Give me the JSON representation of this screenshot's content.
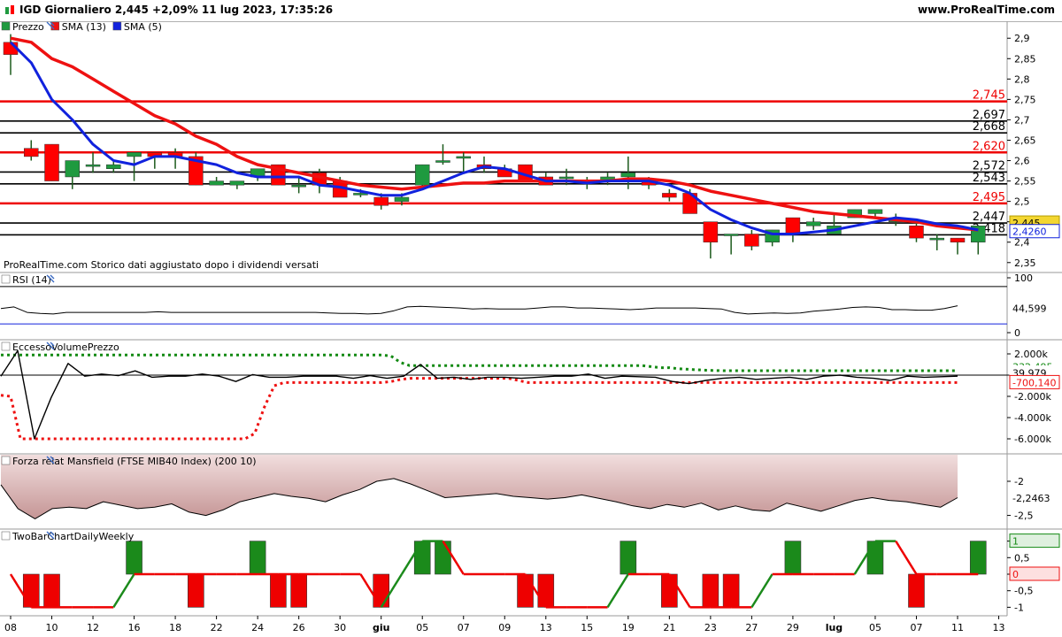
{
  "header": {
    "title": "IGD Giornaliero 2,445 +2,09% 11 lug 2023, 17:35:26",
    "brand": "www.ProRealTime.com",
    "close_label": "✕"
  },
  "colors": {
    "up": "#1f9a3f",
    "down": "#ff0000",
    "sma13": "#ee1111",
    "sma5": "#1122dd",
    "line_red": "#ee0000",
    "line_black": "#000000",
    "rsi_line": "#000000",
    "rsi_level": "#1122dd",
    "evp_green": "#148a14",
    "evp_red": "#ee1111",
    "mansfield_fill": "#d2a4a4",
    "tb_up": "#1b8a1b",
    "tb_down": "#ee0000"
  },
  "x_axis": {
    "labels": [
      "08",
      "10",
      "12",
      "16",
      "18",
      "22",
      "24",
      "26",
      "30",
      "giu",
      "05",
      "07",
      "09",
      "13",
      "15",
      "19",
      "21",
      "23",
      "27",
      "29",
      "lug",
      "05",
      "07",
      "11",
      "13"
    ],
    "label_index": [
      0,
      2,
      4,
      6,
      8,
      10,
      12,
      14,
      16,
      18,
      20,
      22,
      24,
      26,
      28,
      30,
      32,
      34,
      36,
      38,
      40,
      42,
      44,
      46,
      48
    ]
  },
  "price_panel": {
    "legend": [
      {
        "text": "Prezzo",
        "color": "#1f9a3f"
      },
      {
        "text": "SMA (13)",
        "color": "#ee1111"
      },
      {
        "text": "SMA (5)",
        "color": "#1122dd"
      }
    ],
    "note": "ProRealTime.com  Storico dati aggiustato dopo i dividendi versati",
    "y_ticks": [
      "2,9",
      "2,85",
      "2,8",
      "2,75",
      "2,7",
      "2,65",
      "2,6",
      "2,55",
      "2,5",
      "2,45",
      "2,4",
      "2,35"
    ],
    "y_tick_values": [
      2.9,
      2.85,
      2.8,
      2.75,
      2.7,
      2.65,
      2.6,
      2.55,
      2.5,
      2.45,
      2.4,
      2.35
    ],
    "current_price": "2,445",
    "current_sma": "2,4260"
  },
  "chart_data": [
    {
      "type": "candlestick",
      "title": "Prezzo",
      "ylim": [
        2.33,
        2.92
      ],
      "candles": [
        [
          2.89,
          2.91,
          2.81,
          2.86
        ],
        [
          2.63,
          2.65,
          2.6,
          2.61
        ],
        [
          2.64,
          2.64,
          2.55,
          2.55
        ],
        [
          2.56,
          2.59,
          2.53,
          2.6
        ],
        [
          2.59,
          2.62,
          2.57,
          2.59
        ],
        [
          2.58,
          2.6,
          2.57,
          2.59
        ],
        [
          2.61,
          2.62,
          2.55,
          2.62
        ],
        [
          2.62,
          2.62,
          2.58,
          2.61
        ],
        [
          2.62,
          2.63,
          2.58,
          2.61
        ],
        [
          2.61,
          2.62,
          2.54,
          2.54
        ],
        [
          2.54,
          2.56,
          2.54,
          2.55
        ],
        [
          2.54,
          2.55,
          2.53,
          2.55
        ],
        [
          2.56,
          2.58,
          2.55,
          2.58
        ],
        [
          2.59,
          2.59,
          2.54,
          2.54
        ],
        [
          2.54,
          2.56,
          2.52,
          2.54
        ],
        [
          2.57,
          2.58,
          2.52,
          2.54
        ],
        [
          2.55,
          2.56,
          2.51,
          2.51
        ],
        [
          2.52,
          2.53,
          2.51,
          2.52
        ],
        [
          2.51,
          2.52,
          2.48,
          2.49
        ],
        [
          2.5,
          2.52,
          2.49,
          2.51
        ],
        [
          2.54,
          2.59,
          2.53,
          2.59
        ],
        [
          2.6,
          2.64,
          2.59,
          2.6
        ],
        [
          2.61,
          2.62,
          2.57,
          2.61
        ],
        [
          2.59,
          2.61,
          2.57,
          2.58
        ],
        [
          2.58,
          2.59,
          2.57,
          2.56
        ],
        [
          2.59,
          2.59,
          2.55,
          2.55
        ],
        [
          2.56,
          2.57,
          2.54,
          2.54
        ],
        [
          2.56,
          2.58,
          2.54,
          2.56
        ],
        [
          2.55,
          2.56,
          2.53,
          2.55
        ],
        [
          2.55,
          2.57,
          2.54,
          2.56
        ],
        [
          2.56,
          2.61,
          2.53,
          2.57
        ],
        [
          2.55,
          2.56,
          2.53,
          2.54
        ],
        [
          2.52,
          2.53,
          2.5,
          2.51
        ],
        [
          2.52,
          2.53,
          2.47,
          2.47
        ],
        [
          2.45,
          2.45,
          2.36,
          2.4
        ],
        [
          2.42,
          2.42,
          2.37,
          2.42
        ],
        [
          2.42,
          2.43,
          2.38,
          2.39
        ],
        [
          2.4,
          2.43,
          2.39,
          2.43
        ],
        [
          2.46,
          2.46,
          2.4,
          2.42
        ],
        [
          2.44,
          2.46,
          2.43,
          2.45
        ],
        [
          2.42,
          2.47,
          2.42,
          2.44
        ],
        [
          2.46,
          2.48,
          2.46,
          2.48
        ],
        [
          2.47,
          2.48,
          2.46,
          2.48
        ],
        [
          2.45,
          2.47,
          2.44,
          2.46
        ],
        [
          2.44,
          2.45,
          2.4,
          2.41
        ],
        [
          2.41,
          2.42,
          2.38,
          2.41
        ],
        [
          2.41,
          2.41,
          2.37,
          2.4
        ],
        [
          2.4,
          2.44,
          2.37,
          2.44
        ]
      ],
      "sma13": [
        2.9,
        2.89,
        2.85,
        2.83,
        2.8,
        2.77,
        2.74,
        2.71,
        2.69,
        2.66,
        2.64,
        2.61,
        2.59,
        2.58,
        2.57,
        2.56,
        2.55,
        2.54,
        2.535,
        2.53,
        2.535,
        2.54,
        2.545,
        2.545,
        2.55,
        2.55,
        2.55,
        2.55,
        2.55,
        2.55,
        2.555,
        2.555,
        2.55,
        2.54,
        2.525,
        2.515,
        2.505,
        2.495,
        2.485,
        2.475,
        2.47,
        2.465,
        2.46,
        2.455,
        2.45,
        2.44,
        2.435,
        2.43
      ],
      "sma5": [
        2.89,
        2.84,
        2.75,
        2.7,
        2.64,
        2.6,
        2.59,
        2.61,
        2.61,
        2.6,
        2.59,
        2.57,
        2.56,
        2.56,
        2.56,
        2.54,
        2.535,
        2.525,
        2.515,
        2.515,
        2.53,
        2.55,
        2.57,
        2.585,
        2.58,
        2.565,
        2.55,
        2.55,
        2.545,
        2.55,
        2.55,
        2.55,
        2.54,
        2.52,
        2.48,
        2.455,
        2.435,
        2.42,
        2.42,
        2.425,
        2.43,
        2.44,
        2.45,
        2.46,
        2.455,
        2.445,
        2.44,
        2.43
      ],
      "levels": [
        {
          "value": 2.745,
          "label": "2,745",
          "color": "#ee0000"
        },
        {
          "value": 2.697,
          "label": "2,697",
          "color": "#000000"
        },
        {
          "value": 2.668,
          "label": "2,668",
          "color": "#000000"
        },
        {
          "value": 2.62,
          "label": "2,620",
          "color": "#ee0000"
        },
        {
          "value": 2.572,
          "label": "2,572",
          "color": "#000000"
        },
        {
          "value": 2.543,
          "label": "2,543",
          "color": "#000000"
        },
        {
          "value": 2.495,
          "label": "2,495",
          "color": "#ee0000"
        },
        {
          "value": 2.447,
          "label": "2,447",
          "color": "#000000"
        },
        {
          "value": 2.418,
          "label": "2,418",
          "color": "#000000"
        }
      ]
    },
    {
      "type": "line",
      "title": "RSI (14)",
      "ylim": [
        0,
        100
      ],
      "ticks": [
        "100",
        "0"
      ],
      "tick_values": [
        100,
        0
      ],
      "level_top": 84,
      "level_bottom": 16,
      "current": "44,599",
      "values": [
        44,
        47,
        37,
        35,
        34,
        37,
        37,
        37,
        37,
        37,
        37,
        37,
        38,
        37,
        37,
        37,
        37,
        37,
        37,
        37,
        37,
        37,
        37,
        37,
        37,
        36,
        35,
        35,
        34,
        35,
        40,
        47,
        48,
        47,
        46,
        45,
        43,
        44,
        43,
        43,
        43,
        45,
        47,
        47,
        45,
        45,
        44,
        43,
        42,
        43,
        45,
        45,
        45,
        45,
        44,
        43,
        37,
        34,
        35,
        36,
        35,
        36,
        39,
        41,
        43,
        46,
        47,
        46,
        42,
        42,
        41,
        41,
        44,
        49
      ]
    },
    {
      "type": "line",
      "title": "EccessoVolumePrezzo",
      "ylim": [
        -7000,
        2500
      ],
      "ticks": [
        "2.000k",
        "0",
        "-2.000k",
        "-4.000k",
        "-6.000k"
      ],
      "tick_values": [
        2000,
        0,
        -2000,
        -4000,
        -6000
      ],
      "current_green": "332,495",
      "current_black": "39,979",
      "current_red": "-700,140",
      "series": [
        {
          "name": "green",
          "values": [
            1900,
            1900,
            1900,
            1900,
            1900,
            1900,
            1900,
            1900,
            1900,
            1900,
            1900,
            1900,
            1900,
            1900,
            1900,
            1900,
            1900,
            1900,
            1900,
            1900,
            1900,
            1900,
            1900,
            1900,
            1900,
            1900,
            1900,
            1900,
            1900,
            1900,
            1900,
            1900,
            1900,
            1900,
            1900,
            1900,
            1900,
            1900,
            1900,
            1900,
            1900,
            1900,
            1800,
            1200,
            900,
            900,
            900,
            900,
            900,
            900,
            900,
            900,
            900,
            900,
            900,
            900,
            900,
            900,
            900,
            900,
            900,
            900,
            900,
            900,
            900,
            900,
            900,
            900,
            900,
            900,
            800,
            700,
            700,
            600,
            550,
            500,
            460,
            430,
            420,
            420,
            420,
            420,
            420,
            420,
            420,
            420,
            420,
            420,
            420,
            420,
            420,
            420,
            420,
            420,
            420,
            420,
            420,
            420,
            420,
            420,
            420,
            420,
            420,
            420
          ]
        },
        {
          "name": "black",
          "values": [
            -100,
            2300,
            -6000,
            -2100,
            1100,
            -100,
            100,
            -50,
            400,
            -200,
            -100,
            -100,
            100,
            -100,
            -600,
            50,
            -200,
            -200,
            -100,
            -100,
            -100,
            -300,
            -50,
            -300,
            -100,
            1000,
            -300,
            -200,
            -400,
            -200,
            -200,
            -300,
            -200,
            -100,
            -100,
            100,
            -300,
            -100,
            -150,
            -200,
            -600,
            -800,
            -500,
            -300,
            -200,
            -400,
            -300,
            -200,
            -400,
            -100,
            0,
            -200,
            -300,
            -500,
            -100,
            -200,
            -150,
            -100
          ]
        },
        {
          "name": "red",
          "values": [
            -1900,
            -2000,
            -6000,
            -6000,
            -6000,
            -6000,
            -6000,
            -6000,
            -6000,
            -6000,
            -6000,
            -6000,
            -6000,
            -6000,
            -6000,
            -6000,
            -6000,
            -6000,
            -6000,
            -6000,
            -6000,
            -6000,
            -6000,
            -6000,
            -6000,
            -6000,
            -5500,
            -3000,
            -1000,
            -700,
            -700,
            -700,
            -700,
            -700,
            -700,
            -700,
            -700,
            -700,
            -700,
            -700,
            -600,
            -400,
            -300,
            -300,
            -300,
            -300,
            -300,
            -300,
            -300,
            -300,
            -300,
            -300,
            -300,
            -500,
            -700,
            -700,
            -700,
            -700,
            -700,
            -700,
            -700,
            -700,
            -700,
            -700,
            -700,
            -700,
            -700,
            -700,
            -700,
            -700,
            -700,
            -700,
            -700,
            -700,
            -700,
            -700,
            -700,
            -700,
            -700,
            -700,
            -700,
            -700,
            -700,
            -700,
            -700,
            -700,
            -700,
            -700,
            -700,
            -700,
            -700,
            -700,
            -700,
            -700,
            -700,
            -700,
            -700,
            -700,
            -700
          ]
        }
      ]
    },
    {
      "type": "area",
      "title": "Forza relat Mansfield (FTSE MIB40 Index) (200 10)",
      "ylim": [
        -2.7,
        -1.65
      ],
      "ticks": [
        "-2",
        "-2,5"
      ],
      "tick_values": [
        -2,
        -2.5
      ],
      "current": "-2,2463",
      "values": [
        -2.05,
        -2.4,
        -2.55,
        -2.4,
        -2.38,
        -2.4,
        -2.3,
        -2.35,
        -2.4,
        -2.38,
        -2.33,
        -2.45,
        -2.5,
        -2.42,
        -2.3,
        -2.24,
        -2.18,
        -2.22,
        -2.25,
        -2.3,
        -2.2,
        -2.12,
        -2.0,
        -1.96,
        -2.04,
        -2.14,
        -2.24,
        -2.22,
        -2.2,
        -2.18,
        -2.22,
        -2.24,
        -2.26,
        -2.24,
        -2.2,
        -2.25,
        -2.3,
        -2.36,
        -2.4,
        -2.34,
        -2.38,
        -2.32,
        -2.42,
        -2.36,
        -2.42,
        -2.44,
        -2.32,
        -2.38,
        -2.44,
        -2.36,
        -2.28,
        -2.24,
        -2.28,
        -2.3,
        -2.34,
        -2.38,
        -2.24
      ]
    },
    {
      "type": "bar",
      "title": "TwoBarChartDailyWeekly",
      "ylim": [
        -1.15,
        1.15
      ],
      "ticks": [
        "1",
        "0,5",
        "0",
        "-0,5",
        "-1"
      ],
      "tick_values": [
        1,
        0.5,
        0,
        -0.5,
        -1
      ],
      "current_top": "1",
      "current_mid": "0",
      "values": [
        0,
        -1,
        -1,
        0,
        0,
        0,
        1,
        0,
        0,
        -1,
        0,
        0,
        1,
        -1,
        -1,
        0,
        0,
        0,
        -1,
        0,
        1,
        1,
        0,
        0,
        0,
        -1,
        -1,
        0,
        0,
        0,
        1,
        0,
        -1,
        0,
        -1,
        -1,
        0,
        0,
        1,
        0,
        0,
        0,
        1,
        0,
        -1,
        0,
        0,
        1
      ],
      "daily": [
        0,
        -1,
        -1,
        -1,
        -1,
        -1,
        0,
        0,
        0,
        0,
        0,
        0,
        0,
        0,
        0,
        0,
        0,
        0,
        -1,
        0,
        1,
        1,
        0,
        0,
        0,
        0,
        -1,
        -1,
        -1,
        -1,
        0,
        0,
        0,
        -1,
        -1,
        -1,
        -1,
        0,
        0,
        0,
        0,
        0,
        1,
        1,
        0,
        0,
        0,
        0
      ]
    }
  ]
}
